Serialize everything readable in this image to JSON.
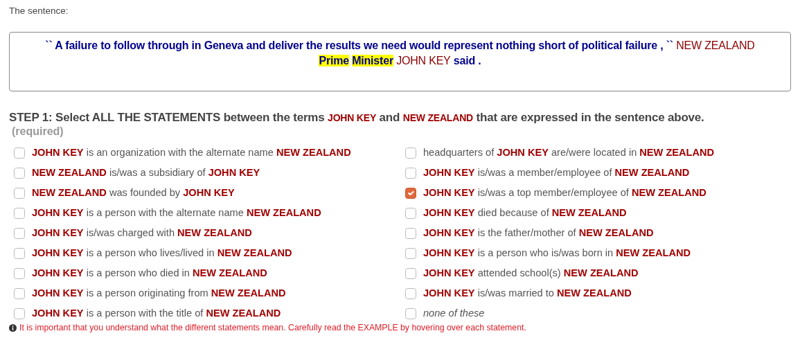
{
  "sentence_label": "The sentence:",
  "sentence": [
    {
      "kind": "text",
      "text": "`` A failure to follow through in Geneva and deliver the results we need would represent nothing short of political failure , ``"
    },
    {
      "kind": "entity",
      "text": "NEW ZEALAND"
    },
    {
      "kind": "trigger",
      "text": "Prime"
    },
    {
      "kind": "trigger",
      "text": "Minister"
    },
    {
      "kind": "entity",
      "text": "JOHN KEY"
    },
    {
      "kind": "text",
      "text": "said ."
    }
  ],
  "step": [
    {
      "kind": "text",
      "text": "STEP 1: Select ALL THE STATEMENTS between the terms"
    },
    {
      "kind": "entity",
      "text": "JOHN KEY"
    },
    {
      "kind": "text",
      "text": "and"
    },
    {
      "kind": "entity",
      "text": "NEW ZEALAND"
    },
    {
      "kind": "text",
      "text": "that are expressed in the sentence above."
    }
  ],
  "required_note": "(required)",
  "statements": [
    {
      "kind": "relation",
      "text": "**JOHN KEY** is an organization with the alternate name **NEW ZEALAND**",
      "checked": false
    },
    {
      "kind": "relation",
      "text": "**NEW ZEALAND** is/was a subsidiary of **JOHN KEY**",
      "checked": false
    },
    {
      "kind": "relation",
      "text": "**NEW ZEALAND** was founded by **JOHN KEY**",
      "checked": false
    },
    {
      "kind": "relation",
      "text": "**JOHN KEY** is a person with the alternate name **NEW ZEALAND**",
      "checked": false
    },
    {
      "kind": "relation",
      "text": "**JOHN KEY** is/was charged with **NEW ZEALAND**",
      "checked": false
    },
    {
      "kind": "relation",
      "text": "**JOHN KEY** is a person who lives/lived in **NEW ZEALAND**",
      "checked": false
    },
    {
      "kind": "relation",
      "text": "**JOHN KEY** is a person who died in **NEW ZEALAND**",
      "checked": false
    },
    {
      "kind": "relation",
      "text": "**JOHN KEY** is a person originating from **NEW ZEALAND**",
      "checked": false
    },
    {
      "kind": "relation",
      "text": "**JOHN KEY** is a person with the title of **NEW ZEALAND**",
      "checked": false
    },
    {
      "kind": "relation",
      "text": "headquarters of **JOHN KEY** are/were located in **NEW ZEALAND**",
      "checked": false
    },
    {
      "kind": "relation",
      "text": "**JOHN KEY** is/was a member/employee of **NEW ZEALAND**",
      "checked": false
    },
    {
      "kind": "relation",
      "text": "**JOHN KEY** is/was a top member/employee of **NEW ZEALAND**",
      "checked": true
    },
    {
      "kind": "relation",
      "text": "**JOHN KEY** died because of **NEW ZEALAND**",
      "checked": false
    },
    {
      "kind": "relation",
      "text": "**JOHN KEY** is the father/mother of **NEW ZEALAND**",
      "checked": false
    },
    {
      "kind": "relation",
      "text": "**JOHN KEY** is a person who is/was born in **NEW ZEALAND**",
      "checked": false
    },
    {
      "kind": "relation",
      "text": "**JOHN KEY** attended school(s) **NEW ZEALAND**",
      "checked": false
    },
    {
      "kind": "relation",
      "text": "**JOHN KEY** is/was married to **NEW ZEALAND**",
      "checked": false
    },
    {
      "kind": "none",
      "text": "none of these",
      "checked": false
    }
  ],
  "info_note": "It is important that you understand what the different statements mean. Carefully read the EXAMPLE by hovering over each statement."
}
